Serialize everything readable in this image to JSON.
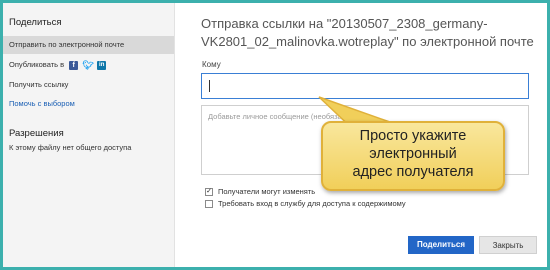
{
  "sidebar": {
    "share_heading": "Поделиться",
    "items": [
      {
        "label": "Отправить по электронной почте",
        "selected": true
      },
      {
        "label": "Опубликовать в"
      },
      {
        "label": "Получить ссылку"
      },
      {
        "label": "Помочь с выбором"
      }
    ],
    "social_icons": [
      "facebook-icon",
      "twitter-icon",
      "linkedin-icon"
    ],
    "permissions_heading": "Разрешения",
    "permissions_text": "К этому файлу нет общего доступа"
  },
  "main": {
    "title": "Отправка ссылки на \"20130507_2308_germany-VK2801_02_malinovka.wotreplay\" по электронной почте",
    "to_label": "Кому",
    "to_value": "",
    "message_placeholder": "Добавьте личное сообщение (необязательно)",
    "options": [
      {
        "label": "Получатели могут изменять",
        "checked": true
      },
      {
        "label": "Требовать вход в службу для доступа к содержимому",
        "checked": false
      }
    ],
    "share_button": "Поделиться",
    "close_button": "Закрыть"
  },
  "callout": {
    "text_line1": "Просто укажите",
    "text_line2": "электронный",
    "text_line3": "адрес получателя"
  },
  "colors": {
    "accent": "#2266c7",
    "frame_background": "#3cb0ad",
    "callout": "#f1cf5a"
  }
}
